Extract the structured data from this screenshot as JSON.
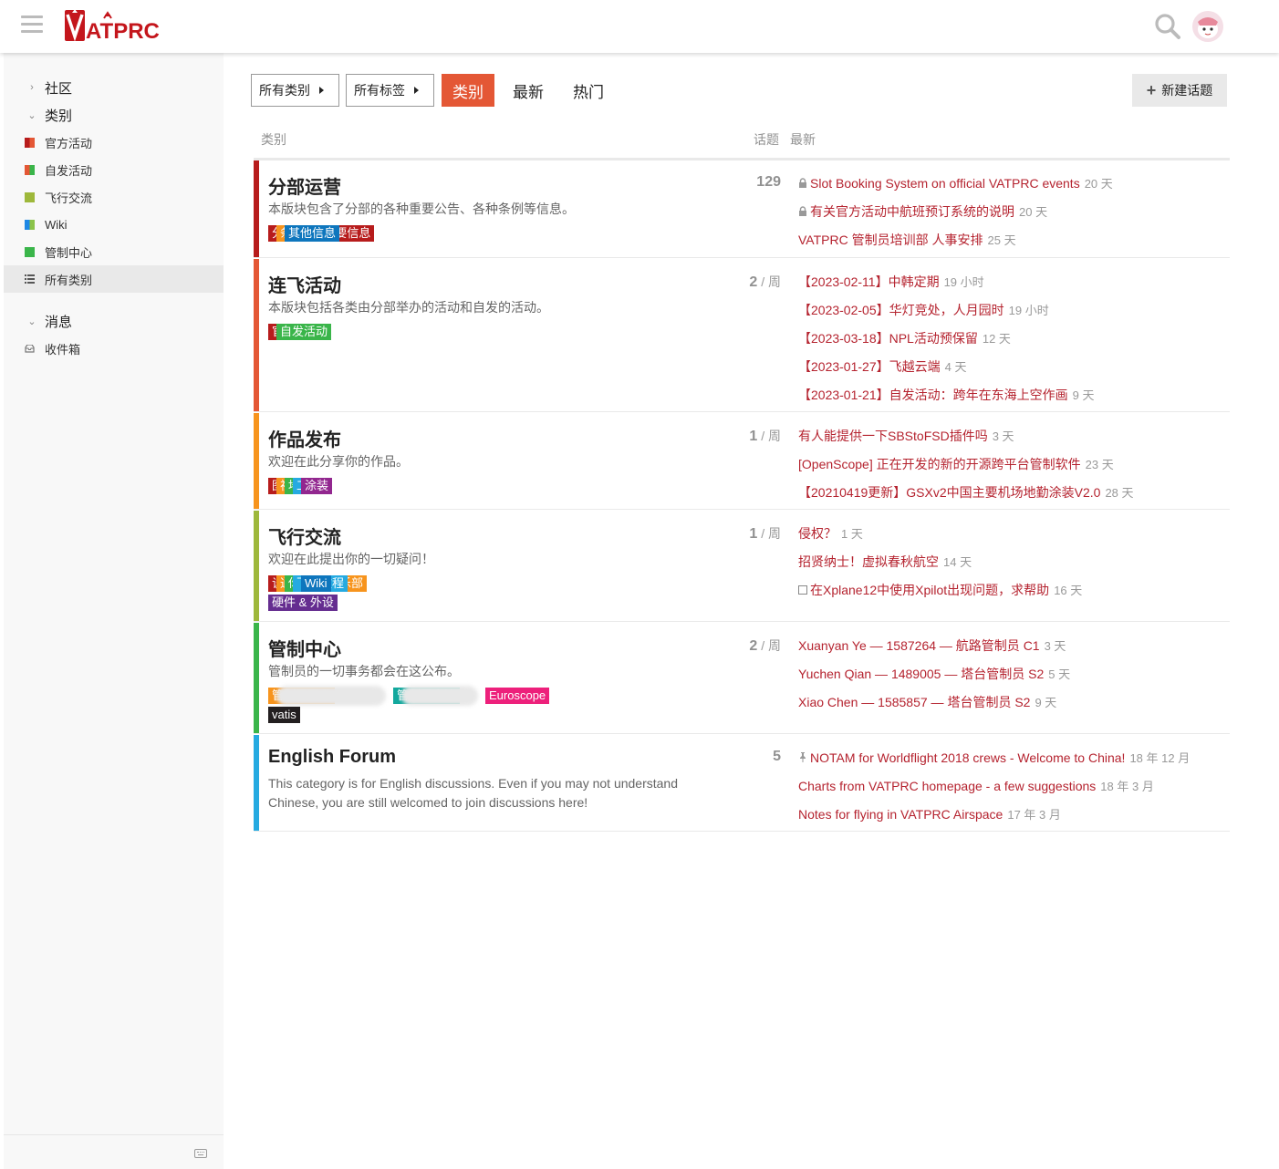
{
  "header": {
    "logo_text": "VATPRC"
  },
  "sidebar": {
    "community_label": "社区",
    "categories_label": "类别",
    "categories": [
      {
        "label": "官方活动",
        "colors": [
          "#b71c1c",
          "#e45735"
        ]
      },
      {
        "label": "自发活动",
        "colors": [
          "#e45735",
          "#3ab54a"
        ]
      },
      {
        "label": "飞行交流",
        "colors": [
          "#9eb83b",
          "#9eb83b"
        ]
      },
      {
        "label": "Wiki",
        "colors": [
          "#1e88e5",
          "#8bc34a"
        ]
      },
      {
        "label": "管制中心",
        "colors": [
          "#3ab54a",
          "#3ab54a"
        ]
      }
    ],
    "all_categories": "所有类别",
    "messages_label": "消息",
    "inbox_label": "收件箱"
  },
  "nav": {
    "category_dropdown": "所有类别",
    "tag_dropdown": "所有标签",
    "tabs": [
      "类别",
      "最新",
      "热门"
    ],
    "new_topic": "新建话题"
  },
  "table_headers": {
    "category": "类别",
    "topics": "话题",
    "latest": "最新"
  },
  "categories": [
    {
      "name": "分部运营",
      "color": "#b71c1c",
      "description": "本版块包含了分部的各种重要公告、各种条例等信息。",
      "count": "129",
      "period": "",
      "subcategories": [
        {
          "label": "分部公告-重要信息",
          "color": "#b71c1c"
        },
        {
          "label": "条例",
          "color": "#f7941d"
        },
        {
          "label": "其他信息",
          "color": "#0e76bd"
        }
      ],
      "topics": [
        {
          "prefix": "lock",
          "title": "Slot Booking System on official VATPRC events",
          "age": "20 天"
        },
        {
          "prefix": "lock",
          "title": "有关官方活动中航班预订系统的说明",
          "age": "20 天"
        },
        {
          "prefix": "",
          "title": "VATPRC 管制员培训部 人事安排",
          "age": "25 天"
        }
      ]
    },
    {
      "name": "连飞活动",
      "color": "#e45735",
      "description": "本版块包括各类由分部举办的活动和自发的活动。",
      "count": "2",
      "period": "/ 周",
      "subcategories": [
        {
          "label": "官方活动",
          "color": "#b71c1c"
        },
        {
          "label": "自发活动",
          "color": "#3ab54a"
        }
      ],
      "topics": [
        {
          "prefix": "",
          "title": "【2023-02-11】中韩定期",
          "age": "19 小时"
        },
        {
          "prefix": "",
          "title": "【2023-02-05】华灯竞处，人月园时",
          "age": "19 小时"
        },
        {
          "prefix": "",
          "title": "【2023-03-18】NPL活动预保留",
          "age": "12 天"
        },
        {
          "prefix": "",
          "title": "【2023-01-27】飞越云端",
          "age": "4 天"
        },
        {
          "prefix": "",
          "title": "【2023-01-21】自发活动：跨年在东海上空作画",
          "age": "9 天"
        }
      ]
    },
    {
      "name": "作品发布",
      "color": "#f7941d",
      "description": "欢迎在此分享你的作品。",
      "count": "1",
      "period": "/ 周",
      "subcategories": [
        {
          "label": "图片",
          "color": "#b71c1c"
        },
        {
          "label": "视频",
          "color": "#f7941d"
        },
        {
          "label": "地景",
          "color": "#3ab54a"
        },
        {
          "label": "工具",
          "color": "#25aae1"
        },
        {
          "label": "涂装",
          "color": "#92278f"
        }
      ],
      "topics": [
        {
          "prefix": "",
          "title": "有人能提供一下SBStoFSD插件吗",
          "age": "3 天"
        },
        {
          "prefix": "",
          "title": "[OpenScope] 正在开发的新的开源跨平台管制软件",
          "age": "23 天"
        },
        {
          "prefix": "",
          "title": "【20210419更新】GSXv2中国主要机场地勤涂装V2.0",
          "age": "28 天"
        }
      ]
    },
    {
      "name": "飞行交流",
      "color": "#9eb83b",
      "description": "欢迎在此提出你的一切疑问！",
      "count": "1",
      "period": "/ 周",
      "subcategories": [
        {
          "label": "谈天说地",
          "color": "#b71c1c"
        },
        {
          "label": "通航飞行俱乐部",
          "color": "#f7941d"
        },
        {
          "label": "你问我答",
          "color": "#3ab54a"
        },
        {
          "label": "飞行教程",
          "color": "#25aae1"
        },
        {
          "label": "Wiki",
          "color": "#0e76bd"
        },
        {
          "label": "硬件 & 外设",
          "color": "#652d90"
        }
      ],
      "topics": [
        {
          "prefix": "",
          "title": "侵权？",
          "age": "1 天"
        },
        {
          "prefix": "",
          "title": "招贤纳士！虚拟春秋航空",
          "age": "14 天"
        },
        {
          "prefix": "box",
          "title": "在Xplane12中使用Xpilot出现问题，求帮助",
          "age": "16 天"
        }
      ]
    },
    {
      "name": "管制中心",
      "color": "#3ab54a",
      "description": "管制员的一切事务都会在这公布。",
      "count": "2",
      "period": "/ 周",
      "subcategories": [
        {
          "label": "管制员晋升",
          "color": "#f7941d"
        },
        {
          "label": "",
          "color": "#e8e8e8"
        },
        {
          "label": "管制员交流",
          "color": "#12a89d"
        },
        {
          "label": "",
          "color": "#e8e8e8"
        },
        {
          "label": "Euroscope",
          "color": "#ed207b"
        },
        {
          "label": "vatis",
          "color": "#231f20"
        }
      ],
      "topics": [
        {
          "prefix": "",
          "title": "Xuanyan Ye — 1587264 — 航路管制员 C1",
          "age": "3 天"
        },
        {
          "prefix": "",
          "title": "Yuchen Qian — 1489005 — 塔台管制员 S2",
          "age": "5 天"
        },
        {
          "prefix": "",
          "title": "Xiao Chen — 1585857 — 塔台管制员 S2",
          "age": "9 天"
        }
      ]
    },
    {
      "name": "English Forum",
      "color": "#25aae1",
      "description": "This category is for English discussions. Even if you may not understand Chinese, you are still welcomed to join discussions here!",
      "count": "5",
      "period": "",
      "subcategories": [],
      "topics": [
        {
          "prefix": "pin",
          "title": "NOTAM for Worldflight 2018 crews - Welcome to China!",
          "age": "18 年 12 月"
        },
        {
          "prefix": "",
          "title": "Charts from VATPRC homepage - a few suggestions",
          "age": "18 年 3 月"
        },
        {
          "prefix": "",
          "title": "Notes for flying in VATPRC Airspace",
          "age": "17 年 3 月"
        }
      ]
    }
  ]
}
